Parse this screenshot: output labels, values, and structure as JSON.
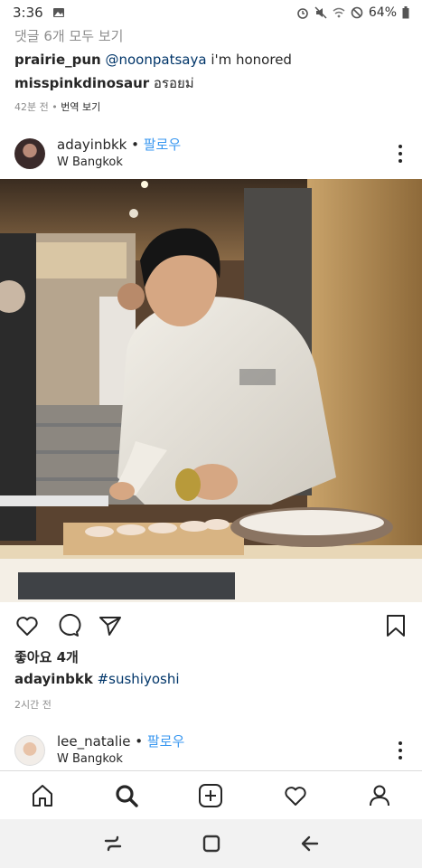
{
  "status_bar": {
    "time": "3:36",
    "battery": "64%"
  },
  "comments": {
    "view_all": "댓글 6개 모두 보기",
    "items": [
      {
        "user": "prairie_pun",
        "mention": "@noonpatsaya",
        "text": " i'm honored"
      },
      {
        "user": "misspinkdinosaur",
        "mention": "",
        "text": " อรอยม่"
      }
    ],
    "meta_time": "42분 전",
    "meta_sep": " • ",
    "meta_translate": "번역 보기"
  },
  "post": {
    "username": "adayinbkk",
    "follow_sep": " • ",
    "follow": "팔로우",
    "location": "W Bangkok",
    "likes": "좋아요 4개",
    "caption_user": "adayinbkk",
    "caption_tag": "#sushiyoshi",
    "time_ago": "2시간 전"
  },
  "next_post": {
    "username": "lee_natalie",
    "follow_sep": " • ",
    "follow": "팔로우",
    "location": "W Bangkok"
  },
  "colors": {
    "link_blue": "#3897f0",
    "mention": "#003569",
    "muted": "#8e8e8e"
  }
}
